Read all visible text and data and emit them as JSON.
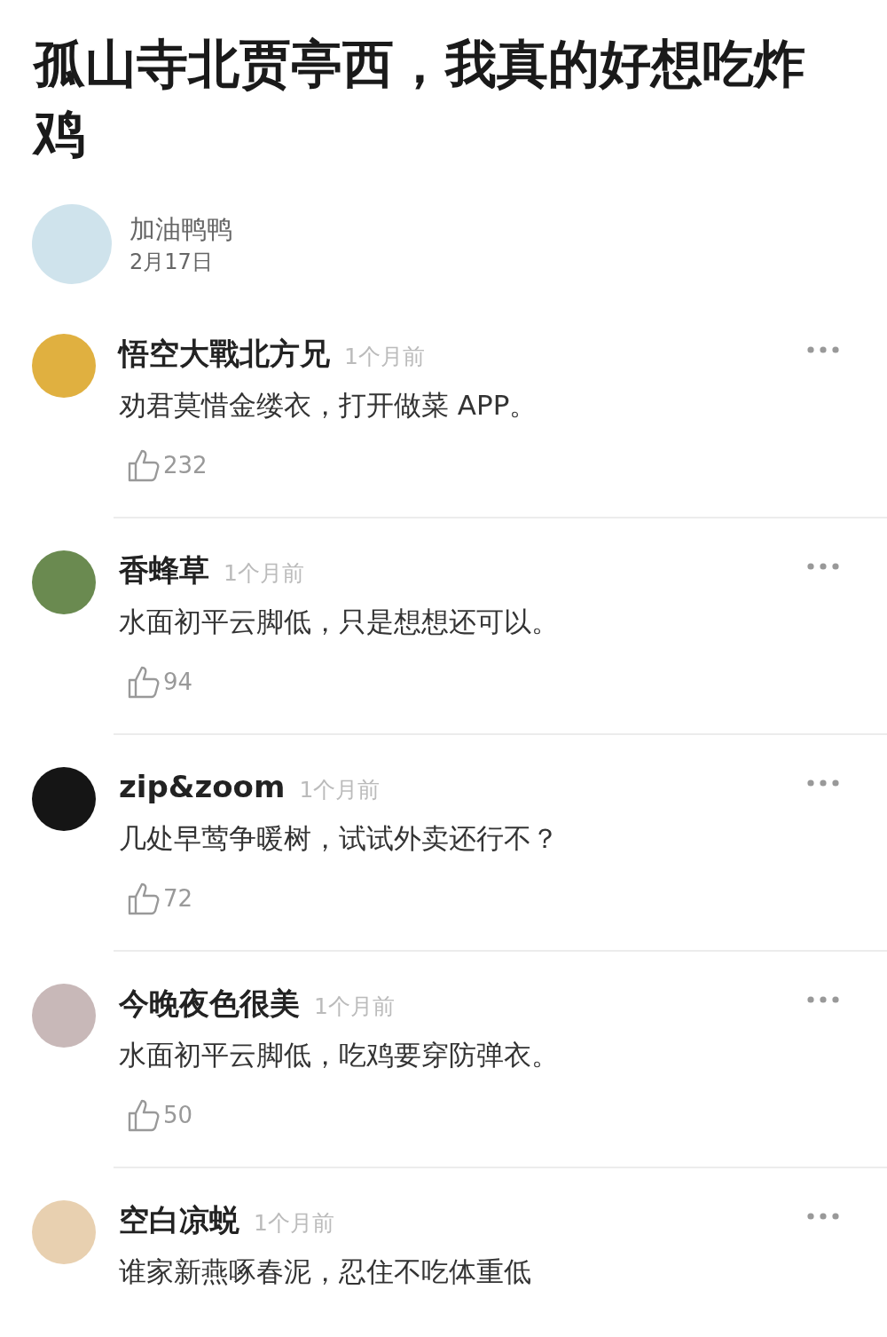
{
  "title": "孤山寺北贾亭西，我真的好想吃炸鸡",
  "author": {
    "name": "加油鸭鸭",
    "date": "2月17日"
  },
  "comments": [
    {
      "author": "悟空大戰北方兄",
      "time": "1个月前",
      "text": "劝君莫惜金缕衣，打开做菜 APP。",
      "likes": "232"
    },
    {
      "author": "香蜂草",
      "time": "1个月前",
      "text": "水面初平云脚低，只是想想还可以。",
      "likes": "94"
    },
    {
      "author": "zip&zoom",
      "time": "1个月前",
      "text": "几处早莺争暖树，试试外卖还行不？",
      "likes": "72"
    },
    {
      "author": "今晚夜色很美",
      "time": "1个月前",
      "text": "水面初平云脚低，吃鸡要穿防弹衣。",
      "likes": "50"
    },
    {
      "author": "空白凉蜕",
      "time": "1个月前",
      "text": "谁家新燕啄春泥，忍住不吃体重低"
    }
  ]
}
